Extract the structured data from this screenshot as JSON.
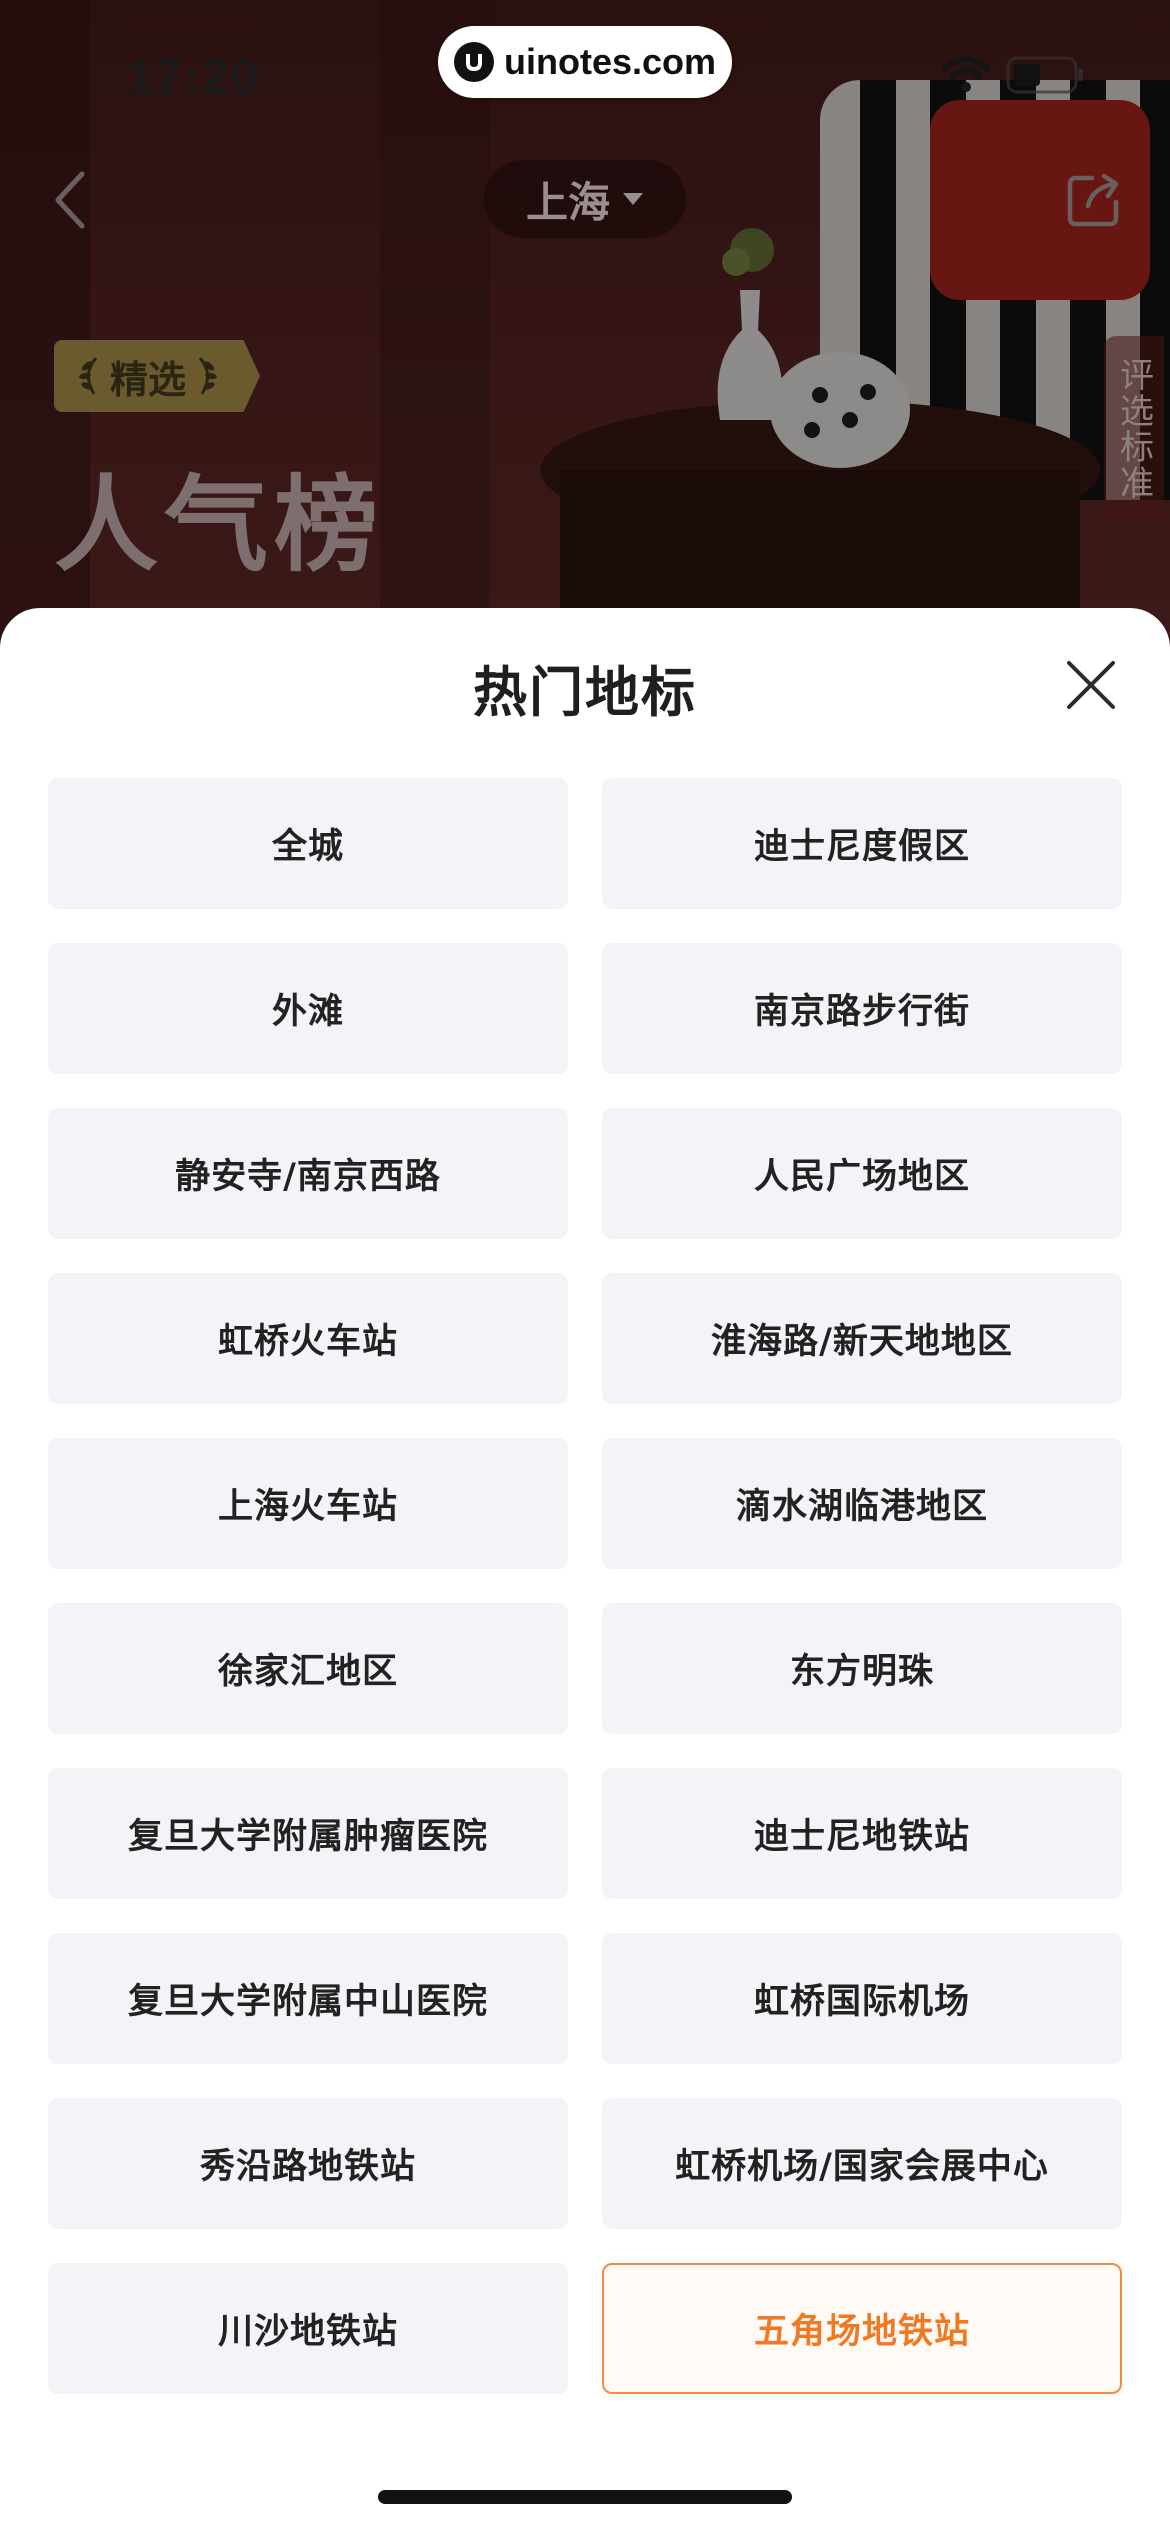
{
  "status_bar": {
    "time": "17:20",
    "url": "uinotes.com"
  },
  "header": {
    "city": "上海",
    "badge_label": "精选",
    "title": "人气榜",
    "side_tab": "评选标准"
  },
  "sheet": {
    "title": "热门地标",
    "selected_index": 19,
    "accent_color": "#f07a24",
    "items": [
      {
        "label": "全城"
      },
      {
        "label": "迪士尼度假区"
      },
      {
        "label": "外滩"
      },
      {
        "label": "南京路步行街"
      },
      {
        "label": "静安寺/南京西路"
      },
      {
        "label": "人民广场地区"
      },
      {
        "label": "虹桥火车站"
      },
      {
        "label": "淮海路/新天地地区"
      },
      {
        "label": "上海火车站"
      },
      {
        "label": "滴水湖临港地区"
      },
      {
        "label": "徐家汇地区"
      },
      {
        "label": "东方明珠"
      },
      {
        "label": "复旦大学附属肿瘤医院"
      },
      {
        "label": "迪士尼地铁站"
      },
      {
        "label": "复旦大学附属中山医院"
      },
      {
        "label": "虹桥国际机场"
      },
      {
        "label": "秀沿路地铁站"
      },
      {
        "label": "虹桥机场/国家会展中心"
      },
      {
        "label": "川沙地铁站"
      },
      {
        "label": "五角场地铁站"
      }
    ]
  }
}
